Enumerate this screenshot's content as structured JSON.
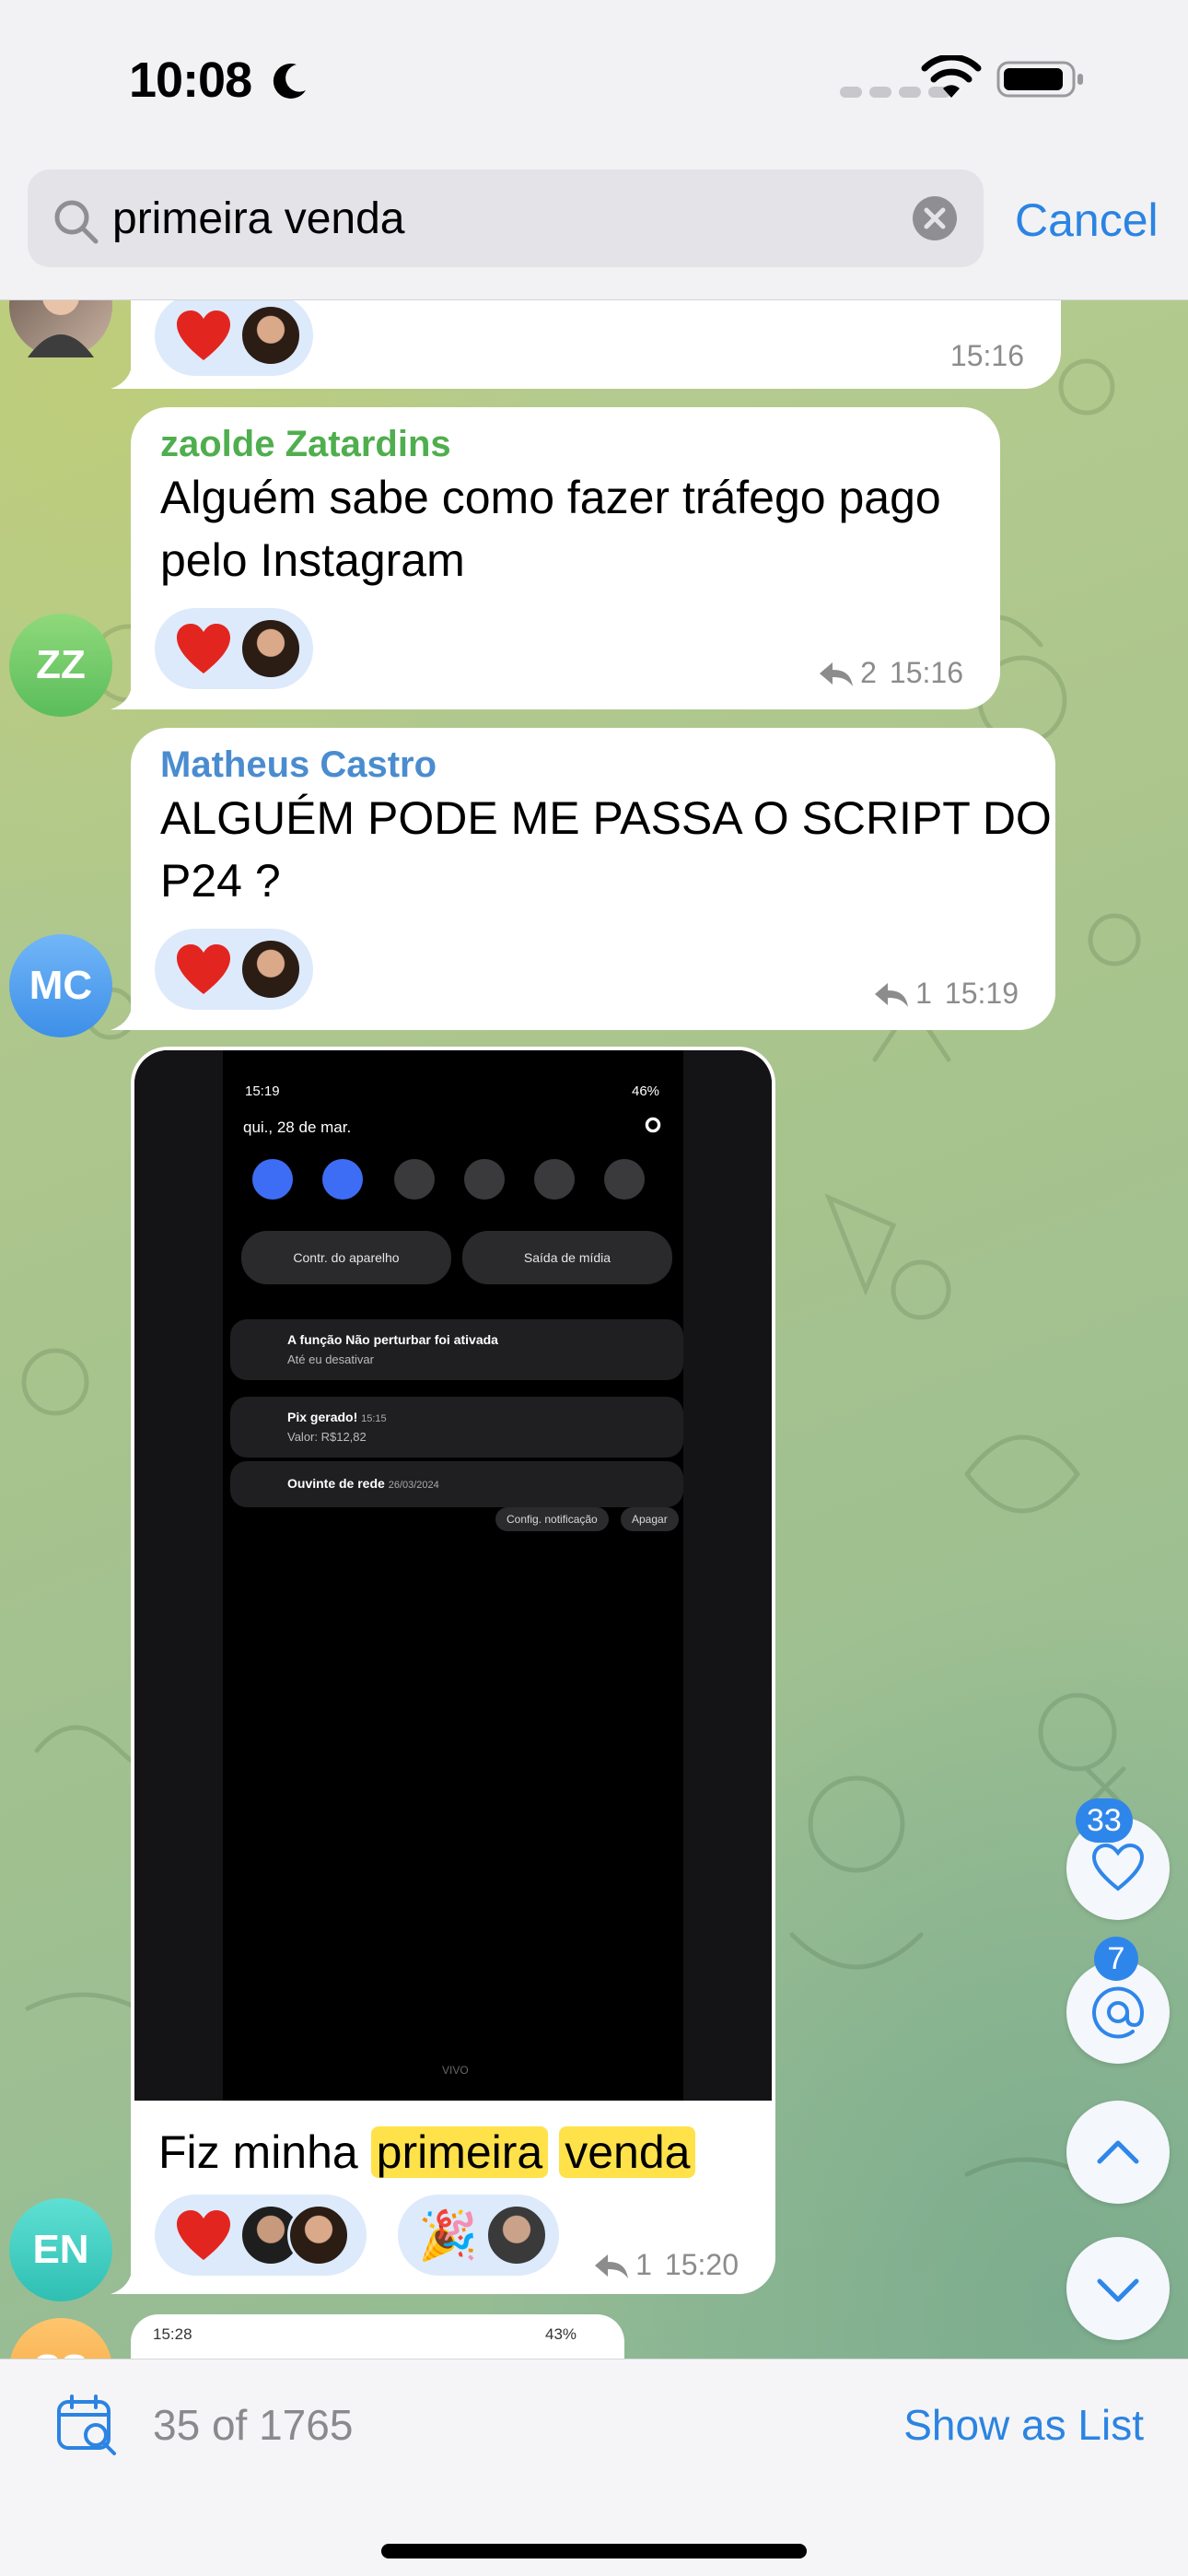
{
  "status_bar": {
    "time": "10:08"
  },
  "search": {
    "query": "primeira venda",
    "cancel_label": "Cancel"
  },
  "messages": [
    {
      "reactions": {
        "heart": "❤"
      },
      "time": "15:16"
    },
    {
      "sender": "zaolde Zatardins",
      "sender_color": "#4fae4e",
      "text_line1": "Alguém sabe como fazer tráfego pago",
      "text_line2": "pelo Instagram",
      "replies": "2",
      "time": "15:16",
      "avatar_initials": "ZZ"
    },
    {
      "sender": "Matheus Castro",
      "sender_color": "#4a8ccf",
      "text_line1": "ALGUÉM PODE ME PASSA O SCRIPT DO",
      "text_line2": "P24 ?",
      "replies": "1",
      "time": "15:19",
      "avatar_initials": "MC"
    },
    {
      "text_before": "Fiz minha",
      "highlight_1": "primeira",
      "highlight_2": "venda",
      "replies": "1",
      "time": "15:20",
      "avatar_initials": "EN",
      "reaction_2_emoji": "🎉",
      "screenshot": {
        "time": "15:19",
        "status_right": "46%",
        "date": "qui., 28 de mar.",
        "button_1": "Contr. do aparelho",
        "button_2": "Saída de mídia",
        "notif_1_title": "A função Não perturbar foi ativada",
        "notif_1_sub": "Até eu desativar",
        "notif_2_title": "Pix gerado!",
        "notif_2_time": "15:15",
        "notif_2_sub": "Valor: R$12,82",
        "notif_3_title": "Ouvinte de rede",
        "notif_3_date": "26/03/2024",
        "chip_1": "Config. notificação",
        "chip_2": "Apagar",
        "carrier": "VIVO"
      }
    },
    {
      "preview_time": "15:28",
      "preview_battery": "43%",
      "avatar_initials": "SS"
    }
  ],
  "floating": {
    "likes_badge": "33",
    "mentions_badge": "7"
  },
  "bottom_bar": {
    "result_count": "35 of 1765",
    "show_as_list": "Show as List"
  },
  "colors": {
    "accent": "#2b84e2",
    "bubble": "#ffffff",
    "reaction_pill": "#dceafb",
    "highlight": "#ffe24a"
  }
}
